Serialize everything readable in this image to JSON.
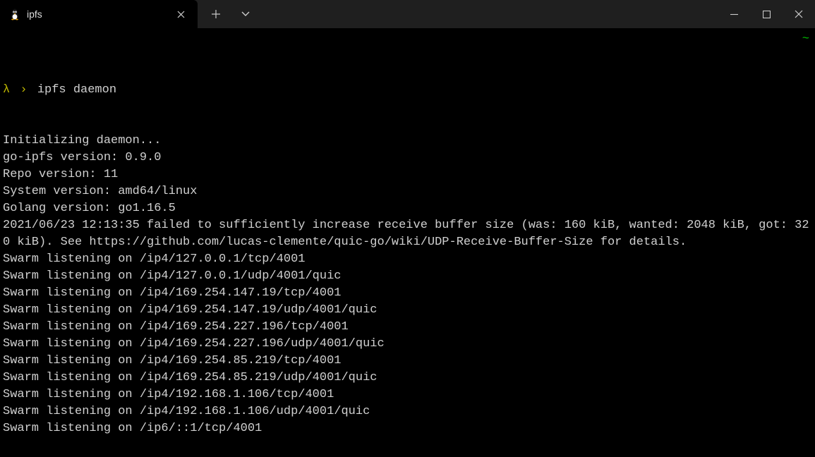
{
  "tab": {
    "title": "ipfs",
    "icon": "penguin-icon"
  },
  "prompt": {
    "lambda": "λ",
    "arrow": "›",
    "command": "ipfs daemon",
    "tilde": "~"
  },
  "output": [
    "Initializing daemon...",
    "go-ipfs version: 0.9.0",
    "Repo version: 11",
    "System version: amd64/linux",
    "Golang version: go1.16.5",
    "2021/06/23 12:13:35 failed to sufficiently increase receive buffer size (was: 160 kiB, wanted: 2048 kiB, got: 320 kiB). See https://github.com/lucas-clemente/quic-go/wiki/UDP-Receive-Buffer-Size for details.",
    "Swarm listening on /ip4/127.0.0.1/tcp/4001",
    "Swarm listening on /ip4/127.0.0.1/udp/4001/quic",
    "Swarm listening on /ip4/169.254.147.19/tcp/4001",
    "Swarm listening on /ip4/169.254.147.19/udp/4001/quic",
    "Swarm listening on /ip4/169.254.227.196/tcp/4001",
    "Swarm listening on /ip4/169.254.227.196/udp/4001/quic",
    "Swarm listening on /ip4/169.254.85.219/tcp/4001",
    "Swarm listening on /ip4/169.254.85.219/udp/4001/quic",
    "Swarm listening on /ip4/192.168.1.106/tcp/4001",
    "Swarm listening on /ip4/192.168.1.106/udp/4001/quic",
    "Swarm listening on /ip6/::1/tcp/4001"
  ]
}
